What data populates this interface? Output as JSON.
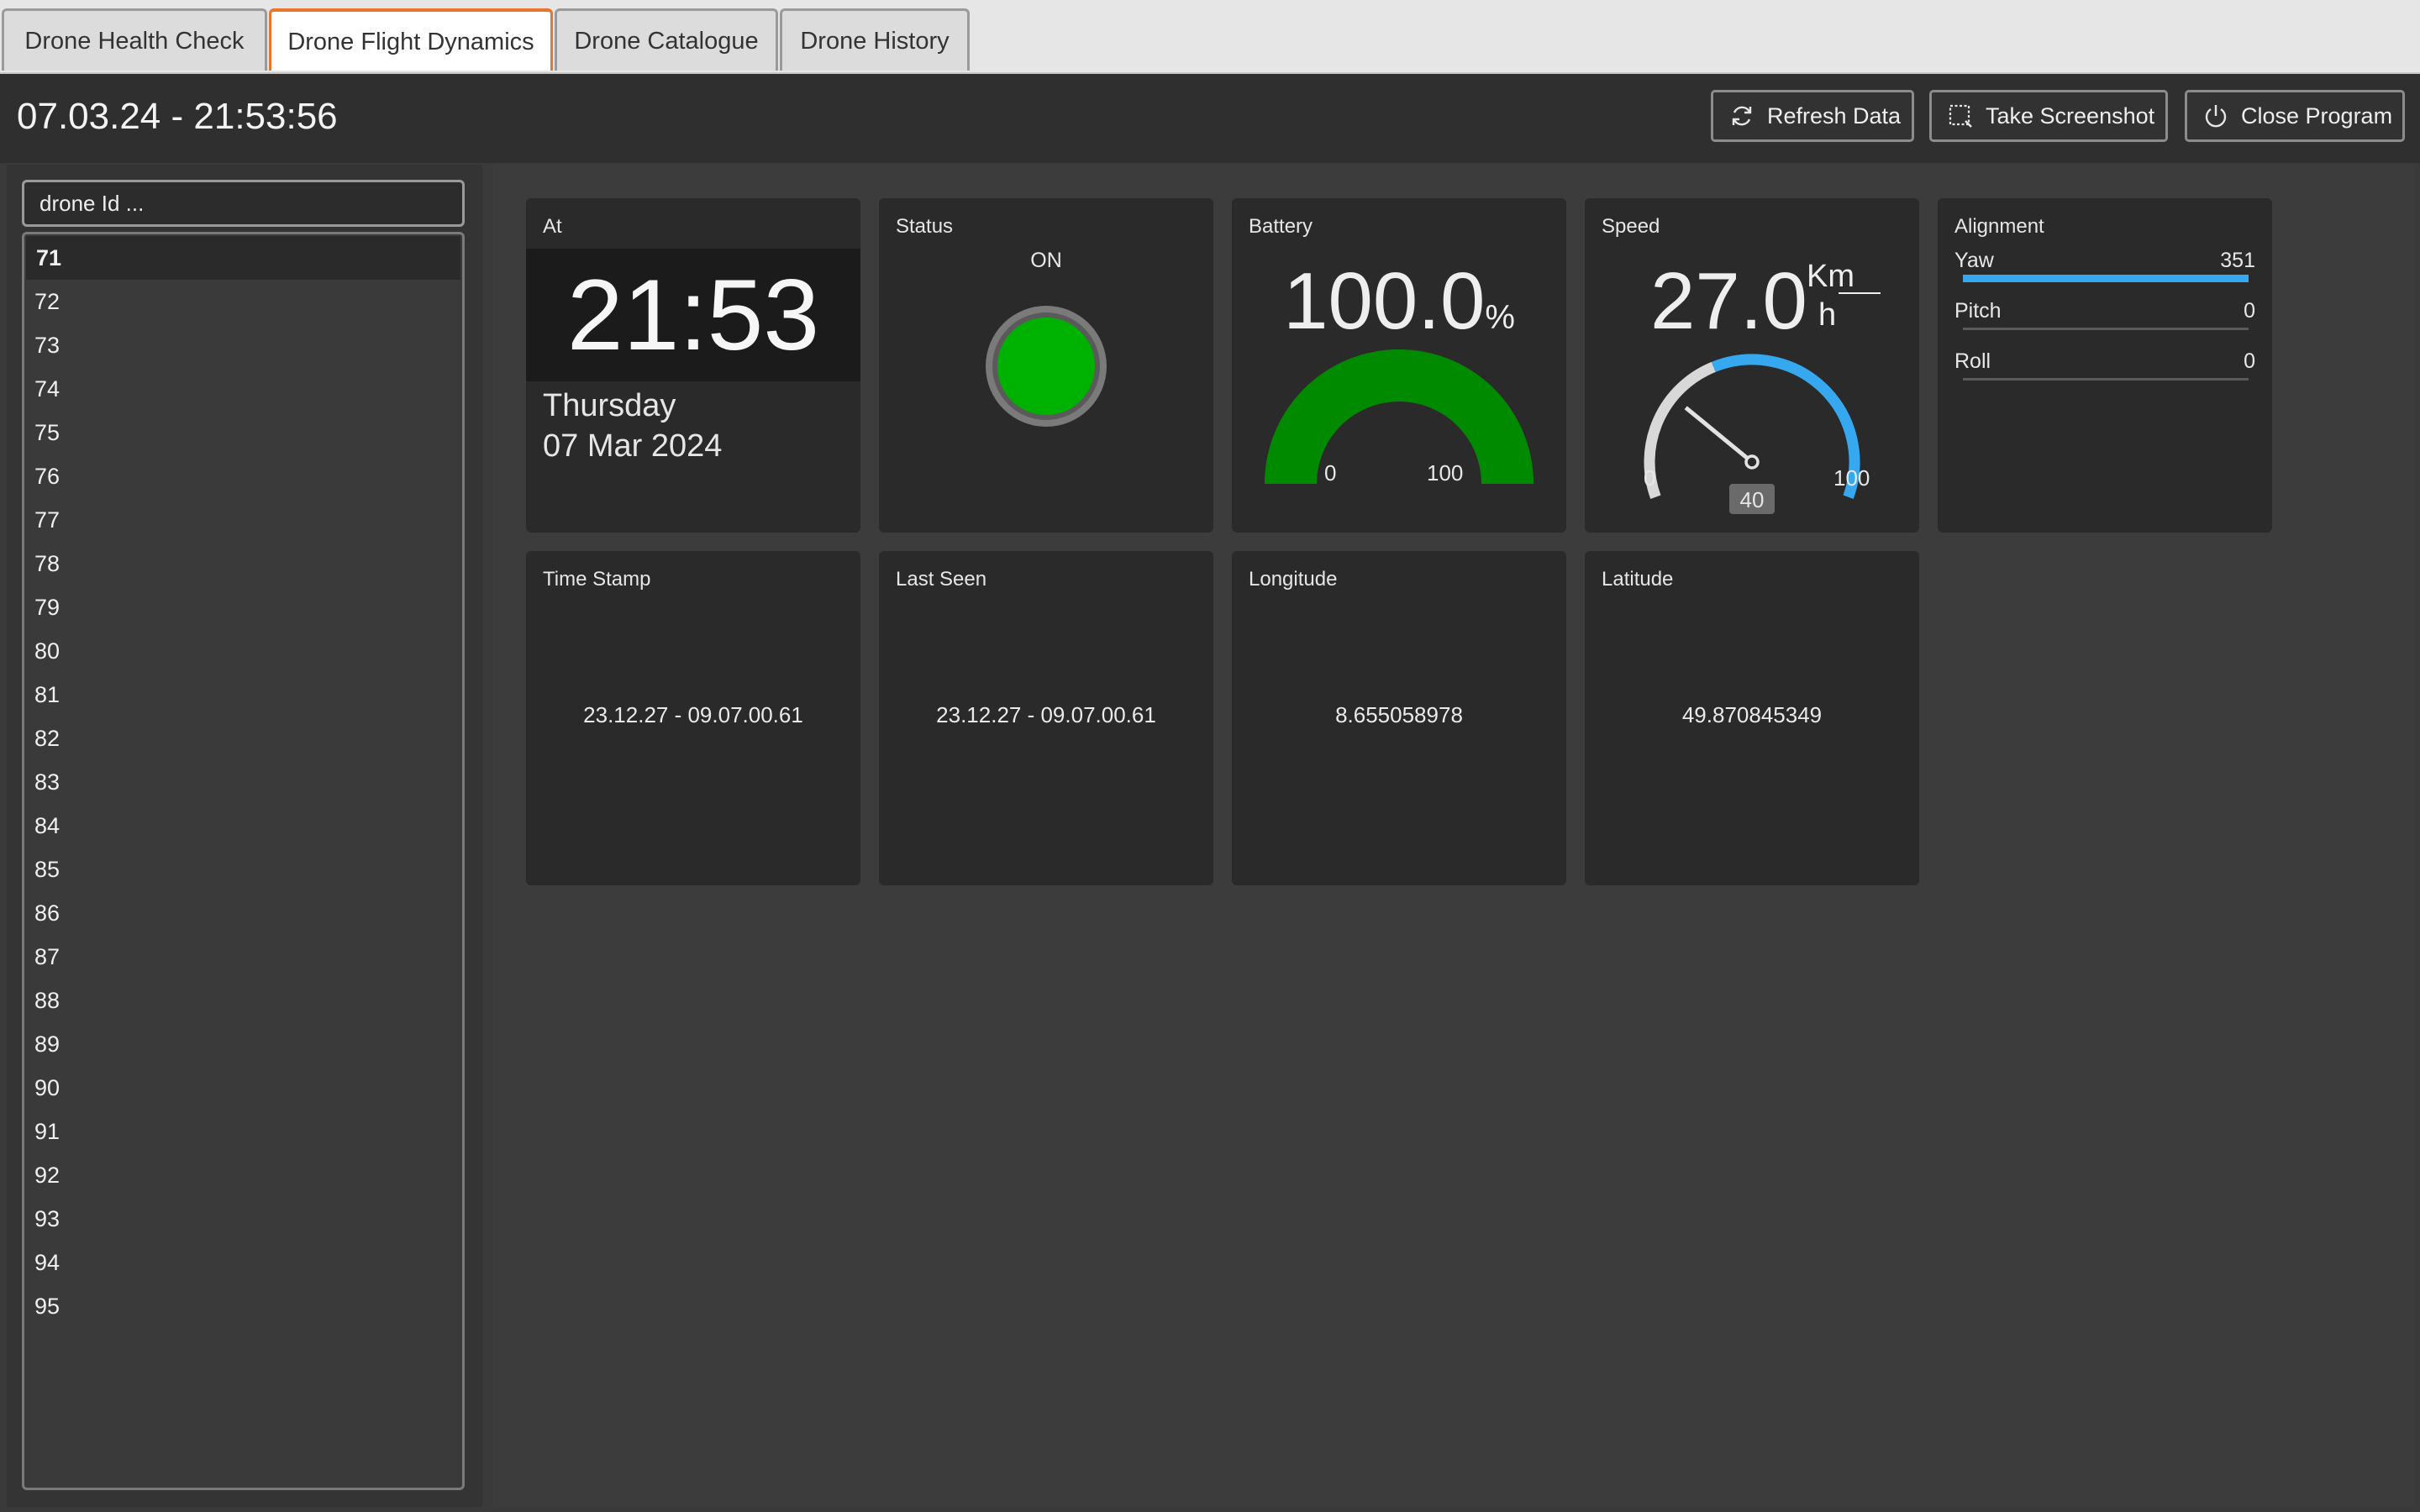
{
  "tabs": [
    {
      "label": "Drone Health Check"
    },
    {
      "label": "Drone Flight Dynamics",
      "active": true
    },
    {
      "label": "Drone Catalogue"
    },
    {
      "label": "Drone History"
    }
  ],
  "toolbar": {
    "datetime": "07.03.24 - 21:53:56",
    "refresh_label": "Refresh Data",
    "screenshot_label": "Take Screenshot",
    "close_label": "Close Program"
  },
  "sidebar": {
    "search_placeholder": "drone Id ...",
    "items": [
      "71",
      "72",
      "73",
      "74",
      "75",
      "76",
      "77",
      "78",
      "79",
      "80",
      "81",
      "82",
      "83",
      "84",
      "85",
      "86",
      "87",
      "88",
      "89",
      "90",
      "91",
      "92",
      "93",
      "94",
      "95"
    ],
    "selected": "71"
  },
  "tiles": {
    "at": {
      "title": "At",
      "time": "21:53",
      "day": "Thursday",
      "date": "07 Mar 2024"
    },
    "status": {
      "title": "Status",
      "value": "ON",
      "color": "#00b200"
    },
    "battery": {
      "title": "Battery",
      "value": "100.0",
      "unit": "%",
      "min": "0",
      "max": "100",
      "level": 100,
      "color": "#008a00"
    },
    "speed": {
      "title": "Speed",
      "value": "27.0",
      "unit_num": "Km",
      "unit_den": "h",
      "min": "0",
      "max": "100",
      "threshold": "40",
      "level": 27,
      "color": "#35a8ef"
    },
    "alignment": {
      "title": "Alignment",
      "rows": [
        {
          "label": "Yaw",
          "value": "351",
          "level": 1.0
        },
        {
          "label": "Pitch",
          "value": "0",
          "level": 0
        },
        {
          "label": "Roll",
          "value": "0",
          "level": 0
        }
      ],
      "color": "#35a8ef"
    },
    "timestamp": {
      "title": "Time Stamp",
      "value": "23.12.27 - 09.07.00.61"
    },
    "last_seen": {
      "title": "Last Seen",
      "value": "23.12.27 - 09.07.00.61"
    },
    "longitude": {
      "title": "Longitude",
      "value": "8.655058978"
    },
    "latitude": {
      "title": "Latitude",
      "value": "49.870845349"
    }
  }
}
